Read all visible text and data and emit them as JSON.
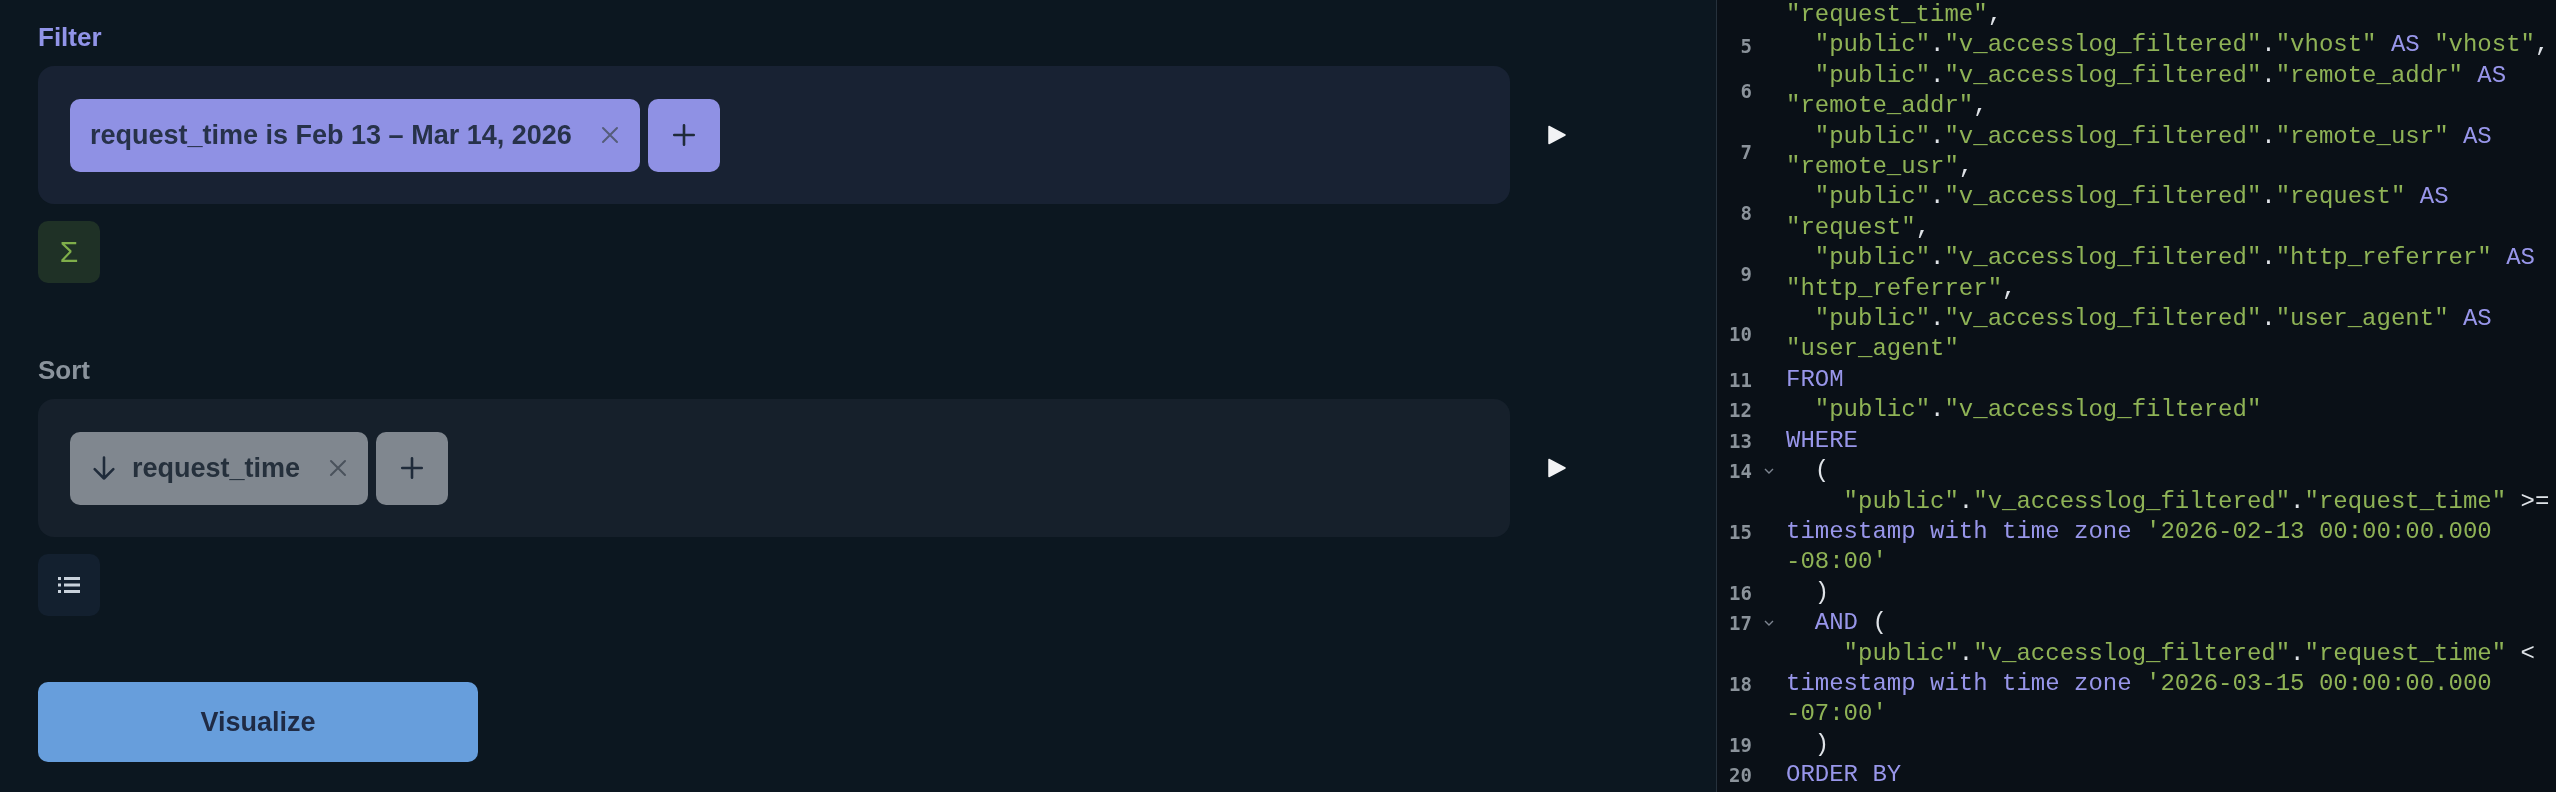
{
  "sections": [
    {
      "kind": "filter",
      "title": "Filter",
      "chips": [
        {
          "text": "request_time is Feb 13 – Mar 14, 2026"
        }
      ],
      "action": {
        "kind": "summarize",
        "glyph": "Σ"
      }
    },
    {
      "kind": "sort",
      "title": "Sort",
      "chips": [
        {
          "text": "request_time",
          "descending": true
        }
      ],
      "action": {
        "kind": "list"
      }
    }
  ],
  "visualize_button": "Visualize",
  "code": {
    "lines": [
      {
        "foldable": false,
        "segments": [
          {
            "kind": "string",
            "t": "\"request_time\""
          },
          {
            "kind": "punct",
            "t": ","
          }
        ]
      },
      {
        "number": "5",
        "foldable": false,
        "segments": [
          {
            "kind": "string",
            "t": "  \"public\""
          },
          {
            "kind": "punct",
            "t": "."
          },
          {
            "kind": "string",
            "t": "\"v_accesslog_filtered\""
          },
          {
            "kind": "punct",
            "t": "."
          },
          {
            "kind": "string",
            "t": "\"vhost\""
          },
          {
            "kind": "keyword",
            "t": " AS "
          },
          {
            "kind": "string",
            "t": "\"vhost\""
          },
          {
            "kind": "punct",
            "t": ","
          }
        ]
      },
      {
        "number": "6",
        "foldable": false,
        "segments": [
          {
            "kind": "string",
            "t": "  \"public\""
          },
          {
            "kind": "punct",
            "t": "."
          },
          {
            "kind": "string",
            "t": "\"v_accesslog_filtered\""
          },
          {
            "kind": "punct",
            "t": "."
          },
          {
            "kind": "string",
            "t": "\"remote_addr\""
          },
          {
            "kind": "keyword",
            "t": " AS "
          },
          {
            "kind": "string",
            "t": "\"remote_addr\""
          },
          {
            "kind": "punct",
            "t": ","
          }
        ]
      },
      {
        "number": "7",
        "foldable": false,
        "segments": [
          {
            "kind": "string",
            "t": "  \"public\""
          },
          {
            "kind": "punct",
            "t": "."
          },
          {
            "kind": "string",
            "t": "\"v_accesslog_filtered\""
          },
          {
            "kind": "punct",
            "t": "."
          },
          {
            "kind": "string",
            "t": "\"remote_usr\""
          },
          {
            "kind": "keyword",
            "t": " AS "
          },
          {
            "kind": "string",
            "t": "\"remote_usr\""
          },
          {
            "kind": "punct",
            "t": ","
          }
        ]
      },
      {
        "number": "8",
        "foldable": false,
        "segments": [
          {
            "kind": "string",
            "t": "  \"public\""
          },
          {
            "kind": "punct",
            "t": "."
          },
          {
            "kind": "string",
            "t": "\"v_accesslog_filtered\""
          },
          {
            "kind": "punct",
            "t": "."
          },
          {
            "kind": "string",
            "t": "\"request\""
          },
          {
            "kind": "keyword",
            "t": " AS "
          },
          {
            "kind": "string",
            "t": "\"request\""
          },
          {
            "kind": "punct",
            "t": ","
          }
        ]
      },
      {
        "number": "9",
        "foldable": false,
        "segments": [
          {
            "kind": "string",
            "t": "  \"public\""
          },
          {
            "kind": "punct",
            "t": "."
          },
          {
            "kind": "string",
            "t": "\"v_accesslog_filtered\""
          },
          {
            "kind": "punct",
            "t": "."
          },
          {
            "kind": "string",
            "t": "\"http_referrer\""
          },
          {
            "kind": "keyword",
            "t": " AS "
          },
          {
            "kind": "string",
            "t": "\"http_referrer\""
          },
          {
            "kind": "punct",
            "t": ","
          }
        ]
      },
      {
        "number": "10",
        "foldable": false,
        "segments": [
          {
            "kind": "string",
            "t": "  \"public\""
          },
          {
            "kind": "punct",
            "t": "."
          },
          {
            "kind": "string",
            "t": "\"v_accesslog_filtered\""
          },
          {
            "kind": "punct",
            "t": "."
          },
          {
            "kind": "string",
            "t": "\"user_agent\""
          },
          {
            "kind": "keyword",
            "t": " AS "
          },
          {
            "kind": "string",
            "t": "\"user_agent\""
          }
        ]
      },
      {
        "number": "11",
        "foldable": false,
        "segments": [
          {
            "kind": "keyword",
            "t": "FROM"
          }
        ]
      },
      {
        "number": "12",
        "foldable": false,
        "segments": [
          {
            "kind": "string",
            "t": "  \"public\""
          },
          {
            "kind": "punct",
            "t": "."
          },
          {
            "kind": "string",
            "t": "\"v_accesslog_filtered\""
          }
        ]
      },
      {
        "number": "13",
        "foldable": false,
        "segments": [
          {
            "kind": "keyword",
            "t": "WHERE"
          }
        ]
      },
      {
        "number": "14",
        "foldable": true,
        "segments": [
          {
            "kind": "punct",
            "t": "  ("
          }
        ]
      },
      {
        "number": "15",
        "foldable": false,
        "segments": [
          {
            "kind": "string",
            "t": "    \"public\""
          },
          {
            "kind": "punct",
            "t": "."
          },
          {
            "kind": "string",
            "t": "\"v_accesslog_filtered\""
          },
          {
            "kind": "punct",
            "t": "."
          },
          {
            "kind": "string",
            "t": "\"request_time\""
          },
          {
            "kind": "punct",
            "t": " >= "
          },
          {
            "kind": "keyword",
            "t": "timestamp with time zone"
          },
          {
            "kind": "string",
            "t": " '2026-02-13 00:00:00.000 -08:00'"
          }
        ]
      },
      {
        "number": "16",
        "foldable": false,
        "segments": [
          {
            "kind": "punct",
            "t": "  )"
          }
        ]
      },
      {
        "number": "17",
        "foldable": true,
        "segments": [
          {
            "kind": "keyword",
            "t": "  AND"
          },
          {
            "kind": "punct",
            "t": " ("
          }
        ]
      },
      {
        "number": "18",
        "foldable": false,
        "segments": [
          {
            "kind": "string",
            "t": "    \"public\""
          },
          {
            "kind": "punct",
            "t": "."
          },
          {
            "kind": "string",
            "t": "\"v_accesslog_filtered\""
          },
          {
            "kind": "punct",
            "t": "."
          },
          {
            "kind": "string",
            "t": "\"request_time\""
          },
          {
            "kind": "punct",
            "t": " < "
          },
          {
            "kind": "keyword",
            "t": "timestamp with time zone"
          },
          {
            "kind": "string",
            "t": " '2026-03-15 00:00:00.000 -07:00'"
          }
        ]
      },
      {
        "number": "19",
        "foldable": false,
        "segments": [
          {
            "kind": "punct",
            "t": "  )"
          }
        ]
      },
      {
        "number": "20",
        "foldable": false,
        "segments": [
          {
            "kind": "keyword",
            "t": "ORDER BY"
          }
        ]
      }
    ]
  }
}
